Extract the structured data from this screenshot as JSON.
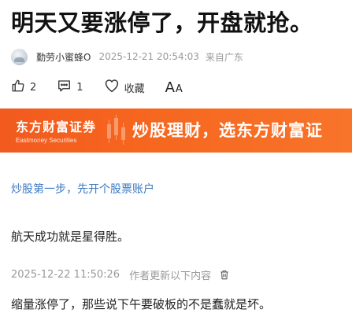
{
  "article": {
    "title": "明天又要涨停了，开盘就抢。",
    "author": "勤劳小蜜蜂O",
    "publish_time": "2025-12-21 20:54:03",
    "source": "来自广东"
  },
  "actions": {
    "like_count": "2",
    "comment_count": "1",
    "favorite_label": "收藏",
    "font_big": "A",
    "font_small": "A"
  },
  "banner": {
    "logo_cn": "东方财富证券",
    "logo_en": "Eastmoney Securities",
    "slogan": "炒股理财，选东方财富证",
    "background_color": "#f6661f"
  },
  "content": {
    "link_text": "炒股第一步，先开个股票账户",
    "paragraph_1": "航天成功就是星得胜。",
    "update_time": "2025-12-22 11:50:26",
    "update_note": "作者更新以下内容",
    "paragraph_2": "缩量涨停了，那些说下午要破板的不是蠢就是坏。"
  },
  "icons": {
    "like": "thumbs-up-icon",
    "comment": "comment-icon",
    "favorite": "heart-icon",
    "delete": "trash-icon"
  }
}
